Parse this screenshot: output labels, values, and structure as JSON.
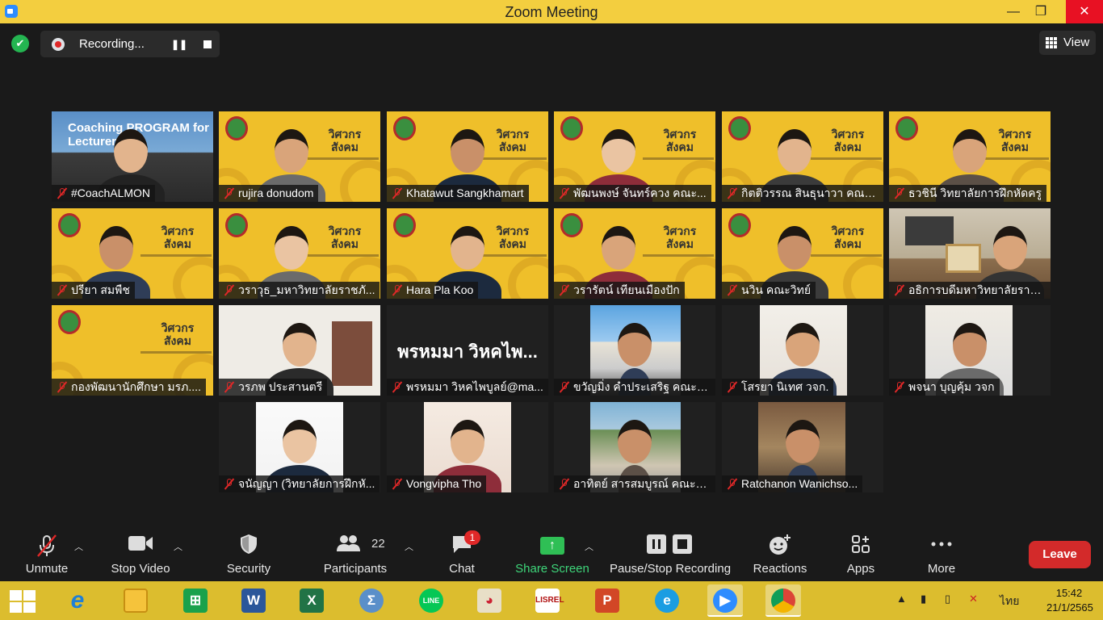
{
  "window": {
    "title": "Zoom Meeting",
    "minimize": "—",
    "maximize": "❐",
    "close": "✕"
  },
  "recording": {
    "label": "Recording...",
    "pause": "❚❚"
  },
  "view_button": {
    "label": "View"
  },
  "participants": [
    {
      "name": "#CoachALMON",
      "kind": "custom",
      "caption": "Coaching PROGRAM for Lecturer"
    },
    {
      "name": "rujira donudom",
      "kind": "banner"
    },
    {
      "name": "Khatawut Sangkhamart",
      "kind": "banner"
    },
    {
      "name": "พัฒนพงษ์ จันทร์ควง คณะ...",
      "kind": "banner"
    },
    {
      "name": "กิตติวรรณ สินธุนาวา คณะ...",
      "kind": "banner"
    },
    {
      "name": "ธวชินี วิทยาลัยการฝึกหัดครู",
      "kind": "banner"
    },
    {
      "name": "ปรียา สมพืช",
      "kind": "banner"
    },
    {
      "name": "วราวุธ_มหาวิทยาลัยราชภั...",
      "kind": "banner"
    },
    {
      "name": "Hara Pla Koo",
      "kind": "banner",
      "active": true
    },
    {
      "name": "วรารัตน์ เทียนเมืองปัก",
      "kind": "banner"
    },
    {
      "name": "นวิน คณะวิทย์",
      "kind": "banner"
    },
    {
      "name": "อธิการบดีมหาวิทยาลัยราช...",
      "kind": "office"
    },
    {
      "name": "กองพัฒนานักศึกษา มรภ....",
      "kind": "banner_empty"
    },
    {
      "name": "วรภพ ประสานตรี",
      "kind": "room"
    },
    {
      "name": "พรหมมา วิหคไพบูลย์@ma...",
      "kind": "text",
      "big": "พรหมมา วิหคไพ..."
    },
    {
      "name": "ขวัญมิ่ง คำประเสริฐ คณะวิ...",
      "kind": "opera"
    },
    {
      "name": "โสรยา นิเทศ วจก.",
      "kind": "portrait"
    },
    {
      "name": "พจนา บุญคุ้ม วจก",
      "kind": "portrait2"
    },
    {
      "name": "จนัญญา (วิทยาลัยการฝึกหั...",
      "kind": "portrait3"
    },
    {
      "name": "Vongvipha Tho",
      "kind": "portrait4"
    },
    {
      "name": "อาทิตย์ สารสมบูรณ์ คณะวิ...",
      "kind": "street"
    },
    {
      "name": "Ratchanon Wanichso...",
      "kind": "restaurant"
    }
  ],
  "toolbar": {
    "unmute": "Unmute",
    "stop_video": "Stop Video",
    "security": "Security",
    "participants": "Participants",
    "participant_count": "22",
    "chat": "Chat",
    "chat_badge": "1",
    "share_screen": "Share Screen",
    "pause_stop_recording": "Pause/Stop Recording",
    "reactions": "Reactions",
    "apps": "Apps",
    "more": "More",
    "leave": "Leave"
  },
  "taskbar": {
    "language": "ไทย",
    "time": "15:42",
    "date": "21/1/2565"
  }
}
